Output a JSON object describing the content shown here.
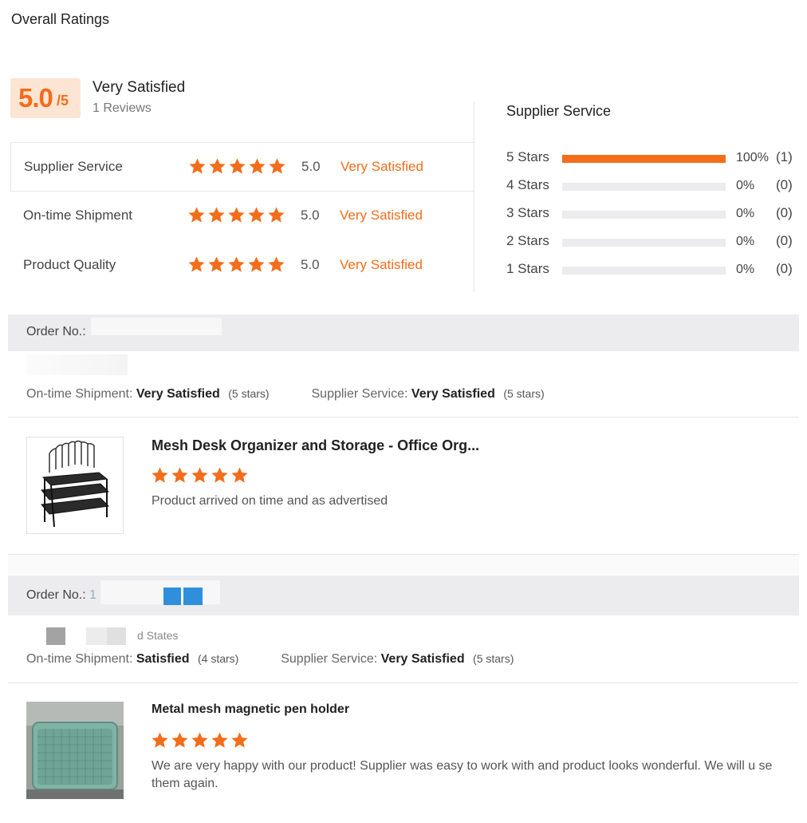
{
  "page": {
    "title": "Overall Ratings"
  },
  "summary": {
    "score": "5.0",
    "out_of": "/5",
    "label": "Very Satisfied",
    "reviews": "1 Reviews",
    "accent": "#f36d1b"
  },
  "categories": [
    {
      "name": "Supplier Service",
      "stars": 5,
      "score": "5.0",
      "level": "Very Satisfied"
    },
    {
      "name": "On-time Shipment",
      "stars": 5,
      "score": "5.0",
      "level": "Very Satisfied"
    },
    {
      "name": "Product Quality",
      "stars": 5,
      "score": "5.0",
      "level": "Very Satisfied"
    }
  ],
  "distribution": {
    "title": "Supplier Service",
    "rows": [
      {
        "label": "5 Stars",
        "percent": "100%",
        "count": "(1)",
        "fraction": 1.0
      },
      {
        "label": "4 Stars",
        "percent": "0%",
        "count": "(0)",
        "fraction": 0
      },
      {
        "label": "3 Stars",
        "percent": "0%",
        "count": "(0)",
        "fraction": 0
      },
      {
        "label": "2 Stars",
        "percent": "0%",
        "count": "(0)",
        "fraction": 0
      },
      {
        "label": "1 Stars",
        "percent": "0%",
        "count": "(0)",
        "fraction": 0
      }
    ]
  },
  "reviews": [
    {
      "order_label": "Order No.:",
      "order_number_visible": "",
      "country_visible": "",
      "shipment_label": "On-time Shipment:",
      "shipment_value": "Very Satisfied",
      "shipment_stars": "(5 stars)",
      "service_label": "Supplier Service:",
      "service_value": "Very Satisfied",
      "service_stars": "(5 stars)",
      "product_name": "Mesh Desk Organizer and Storage - Office Org...",
      "product_stars": 5,
      "comment": "Product arrived on time and as advertised"
    },
    {
      "order_label": "Order No.:",
      "order_number_visible": "1",
      "country_visible": "d States",
      "shipment_label": "On-time Shipment:",
      "shipment_value": "Satisfied",
      "shipment_stars": "(4 stars)",
      "service_label": "Supplier Service:",
      "service_value": "Very Satisfied",
      "service_stars": "(5 stars)",
      "product_name": "Metal mesh magnetic pen holder",
      "product_stars": 5,
      "comment": "We are very happy with our product! Supplier was easy to work with and product looks wonderful.  We will u se them again."
    }
  ]
}
